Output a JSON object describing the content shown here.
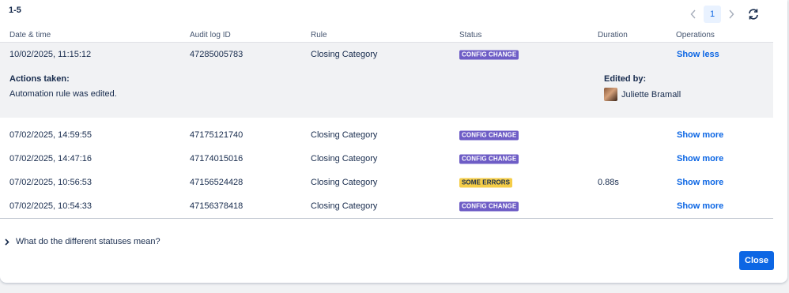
{
  "range_label": "1-5",
  "pagination": {
    "current_page": "1"
  },
  "columns": [
    "Date & time",
    "Audit log ID",
    "Rule",
    "Status",
    "Duration",
    "Operations"
  ],
  "rows": [
    {
      "datetime": "10/02/2025, 11:15:12",
      "log_id": "47285005783",
      "rule": "Closing Category",
      "status": "CONFIG CHANGE",
      "status_type": "config",
      "duration": "",
      "operation": "Show less"
    },
    {
      "datetime": "07/02/2025, 14:59:55",
      "log_id": "47175121740",
      "rule": "Closing Category",
      "status": "CONFIG CHANGE",
      "status_type": "config",
      "duration": "",
      "operation": "Show more"
    },
    {
      "datetime": "07/02/2025, 14:47:16",
      "log_id": "47174015016",
      "rule": "Closing Category",
      "status": "CONFIG CHANGE",
      "status_type": "config",
      "duration": "",
      "operation": "Show more"
    },
    {
      "datetime": "07/02/2025, 10:56:53",
      "log_id": "47156524428",
      "rule": "Closing Category",
      "status": "SOME ERRORS",
      "status_type": "errors",
      "duration": "0.88s",
      "operation": "Show more"
    },
    {
      "datetime": "07/02/2025, 10:54:33",
      "log_id": "47156378418",
      "rule": "Closing Category",
      "status": "CONFIG CHANGE",
      "status_type": "config",
      "duration": "",
      "operation": "Show more"
    }
  ],
  "expanded": {
    "actions_label": "Actions taken:",
    "actions_text": "Automation rule was edited.",
    "edited_by_label": "Edited by:",
    "editor_name": "Juliette Bramall"
  },
  "faq_label": "What do the different statuses mean?",
  "close_label": "Close",
  "colors": {
    "config_change": "#6e5dc6",
    "some_errors": "#f5cd47",
    "link": "#0c66e4",
    "primary_button": "#0c66e4"
  }
}
